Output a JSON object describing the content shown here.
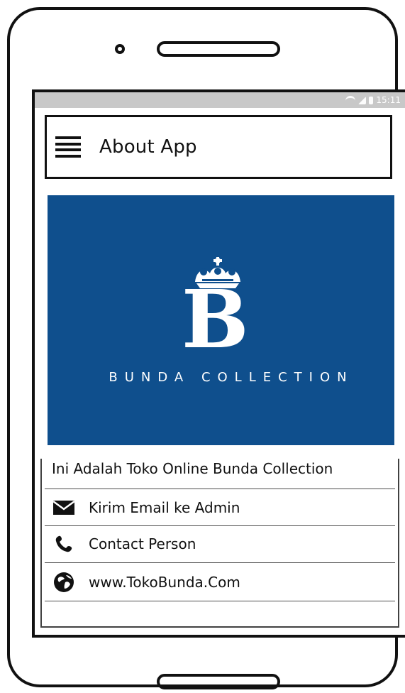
{
  "status_bar": {
    "time": "15:11",
    "icons": [
      "wifi-icon",
      "signal-icon",
      "battery-icon"
    ]
  },
  "app_bar": {
    "menu_icon": "menu-icon",
    "title": "About App"
  },
  "banner": {
    "logo_letter": "B",
    "brand_name": "BUNDA COLLECTION",
    "crown_icon": "crown-icon",
    "background_color": "#0f4f8d"
  },
  "content": {
    "description": "Ini Adalah Toko Online Bunda Collection",
    "actions": [
      {
        "icon": "mail-icon",
        "label": "Kirim Email ke Admin"
      },
      {
        "icon": "phone-icon",
        "label": "Contact Person"
      },
      {
        "icon": "globe-icon",
        "label": "www.TokoBunda.Com"
      }
    ]
  }
}
